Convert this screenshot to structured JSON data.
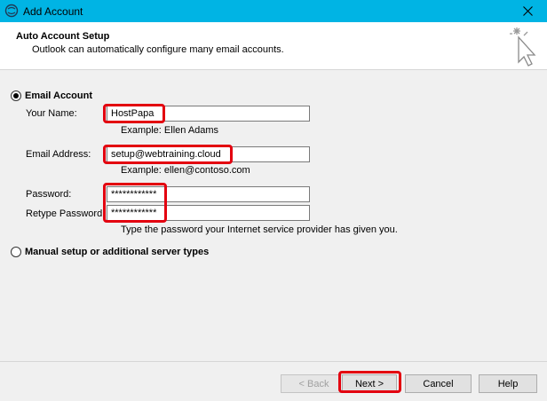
{
  "window": {
    "title": "Add Account"
  },
  "header": {
    "title": "Auto Account Setup",
    "subtitle": "Outlook can automatically configure many email accounts."
  },
  "email_account": {
    "radio_label": "Email Account",
    "your_name": {
      "label": "Your Name:",
      "value": "HostPapa",
      "hint": "Example: Ellen Adams"
    },
    "email_address": {
      "label": "Email Address:",
      "value": "setup@webtraining.cloud",
      "hint": "Example: ellen@contoso.com"
    },
    "password": {
      "label": "Password:",
      "value": "************"
    },
    "retype_password": {
      "label": "Retype Password:",
      "value": "************",
      "hint": "Type the password your Internet service provider has given you."
    }
  },
  "manual_setup": {
    "radio_label": "Manual setup or additional server types"
  },
  "buttons": {
    "back": "< Back",
    "next": "Next >",
    "cancel": "Cancel",
    "help": "Help"
  },
  "colors": {
    "titlebar": "#00b4e4",
    "highlight": "#e3000f"
  },
  "icons": {
    "app": "outlook-app-icon",
    "close": "close-icon",
    "wizard": "magic-wand-cursor-icon"
  }
}
